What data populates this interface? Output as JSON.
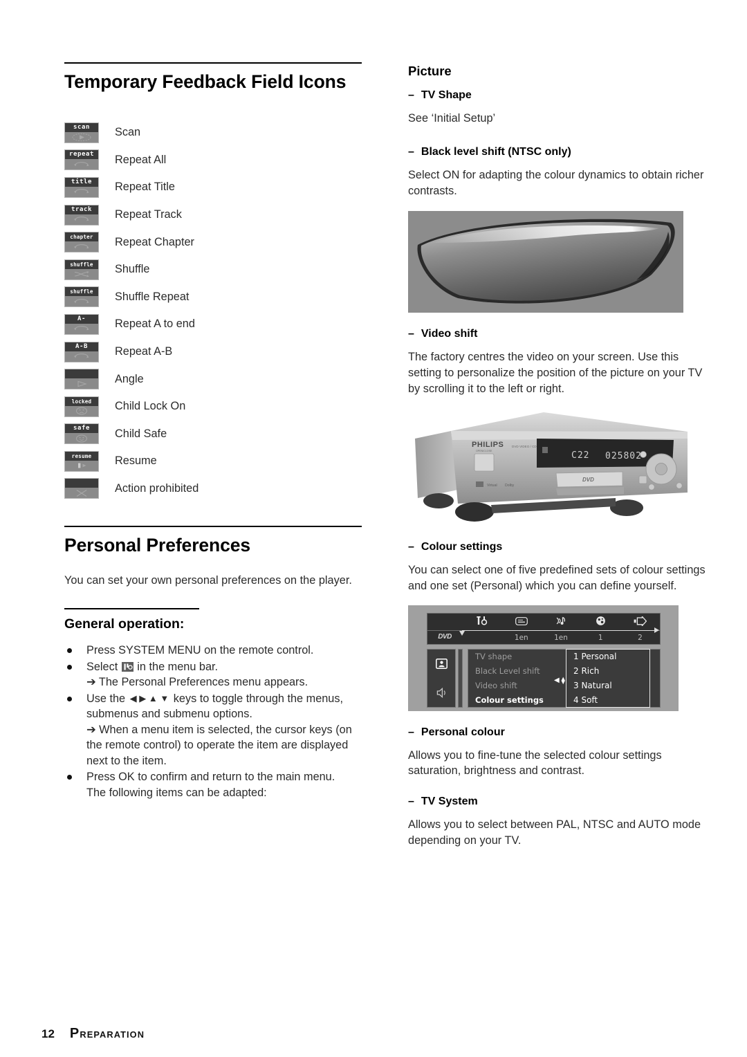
{
  "left": {
    "section_title": "Temporary Feedback Field Icons",
    "icons": [
      {
        "cap": "scan",
        "glyph": "scan-arrow-icon",
        "label": "Scan"
      },
      {
        "cap": "repeat",
        "glyph": "repeat-loop-icon",
        "label": "Repeat All"
      },
      {
        "cap": "title",
        "glyph": "repeat-loop-icon",
        "label": "Repeat Title"
      },
      {
        "cap": "track",
        "glyph": "repeat-loop-icon",
        "label": "Repeat Track"
      },
      {
        "cap": "chapter",
        "glyph": "repeat-loop-icon",
        "label": "Repeat Chapter"
      },
      {
        "cap": "shuffle",
        "glyph": "shuffle-cross-icon",
        "label": "Shuffle"
      },
      {
        "cap": "shuffle",
        "glyph": "repeat-loop-icon",
        "label": "Shuffle Repeat"
      },
      {
        "cap": "A-",
        "glyph": "repeat-loop-icon",
        "label": "Repeat A to end"
      },
      {
        "cap": "A-B",
        "glyph": "repeat-loop-icon",
        "label": "Repeat A-B"
      },
      {
        "cap": "",
        "glyph": "angle-triangle-icon",
        "label": "Angle"
      },
      {
        "cap": "locked",
        "glyph": "sad-face-icon",
        "label": "Child Lock On"
      },
      {
        "cap": "safe",
        "glyph": "happy-face-icon",
        "label": "Child Safe"
      },
      {
        "cap": "resume",
        "glyph": "resume-play-icon",
        "label": "Resume"
      },
      {
        "cap": "",
        "glyph": "cross-prohibited-icon",
        "label": "Action prohibited"
      }
    ],
    "prefs_title": "Personal Preferences",
    "prefs_intro": "You can set your own personal preferences on the player.",
    "general_title": "General operation:",
    "bullets": [
      {
        "text": "Press SYSTEM MENU on the remote control."
      },
      {
        "text_before": "Select ",
        "icon": "preferences-menu-icon",
        "text_after": " in the menu bar.",
        "sub": "➔ The Personal Preferences menu appears."
      },
      {
        "text_before": "Use the ",
        "keys": "◀ ▶ ▲ ▼",
        "text_after": " keys to toggle through the menus, submenus and submenu options.",
        "sub": "➔ When a menu item is selected, the cursor keys (on the remote control) to operate the item are displayed next to the item."
      },
      {
        "text": "Press OK to confirm and return to the main menu.",
        "sub2": "The following items can be adapted:"
      }
    ]
  },
  "right": {
    "picture_title": "Picture",
    "items": [
      {
        "head": "TV Shape",
        "body": "See ‘Initial Setup’"
      },
      {
        "head": "Black level shift (NTSC only)",
        "body": "Select ON for adapting the colour dynamics to obtain richer contrasts."
      },
      {
        "head": "Video shift",
        "body": "The factory centres the video on your screen. Use this setting to personalize the position of the picture on your TV by scrolling it to the left or right."
      },
      {
        "head": "Colour settings",
        "body": "You can select one of five predefined sets of colour settings and one set (Personal) which you can define yourself."
      },
      {
        "head": "Personal colour",
        "body": "Allows you to fine-tune the selected colour settings saturation, brightness and contrast."
      },
      {
        "head": "TV System",
        "body": "Allows you to select between PAL, NTSC and AUTO mode depending on your TV."
      }
    ],
    "dash": "–",
    "figures": {
      "tv_shape_alt": "tv-screen-shape-photo",
      "player_alt": "philips-dvd-player-photo",
      "player_display": "C22  025802",
      "player_brand": "PHILIPS"
    },
    "osd": {
      "menubar_icons": [
        "tools-icon",
        "subtitle-icon",
        "audio-icon",
        "language-globe-icon",
        "output-icon"
      ],
      "menubar_values": [
        "",
        "1en",
        "1en",
        "1",
        "2"
      ],
      "disc_tag": "DVD",
      "side_icons": [
        "picture-person-icon",
        "sound-speaker-icon"
      ],
      "menu_items": [
        "TV shape",
        "Black Level shift",
        "Video shift",
        "Colour settings"
      ],
      "active_menu_item": "Colour settings",
      "values": [
        "1 Personal",
        "2 Rich",
        "3 Natural",
        "4 Soft"
      ],
      "selected_value": "3 Natural"
    }
  },
  "footer": {
    "page_number": "12",
    "section_first": "P",
    "section_rest": "REPARATION"
  }
}
